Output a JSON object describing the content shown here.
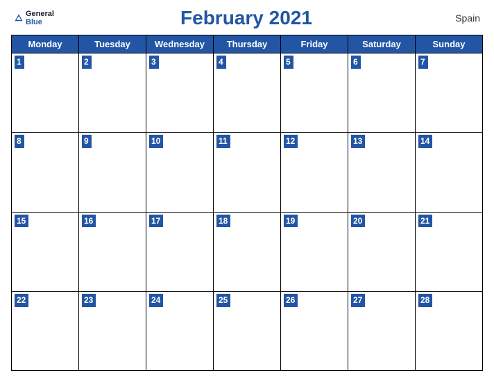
{
  "header": {
    "logo_general": "General",
    "logo_blue": "Blue",
    "title": "February 2021",
    "country": "Spain"
  },
  "days": [
    "Monday",
    "Tuesday",
    "Wednesday",
    "Thursday",
    "Friday",
    "Saturday",
    "Sunday"
  ],
  "weeks": [
    [
      1,
      2,
      3,
      4,
      5,
      6,
      7
    ],
    [
      8,
      9,
      10,
      11,
      12,
      13,
      14
    ],
    [
      15,
      16,
      17,
      18,
      19,
      20,
      21
    ],
    [
      22,
      23,
      24,
      25,
      26,
      27,
      28
    ]
  ]
}
